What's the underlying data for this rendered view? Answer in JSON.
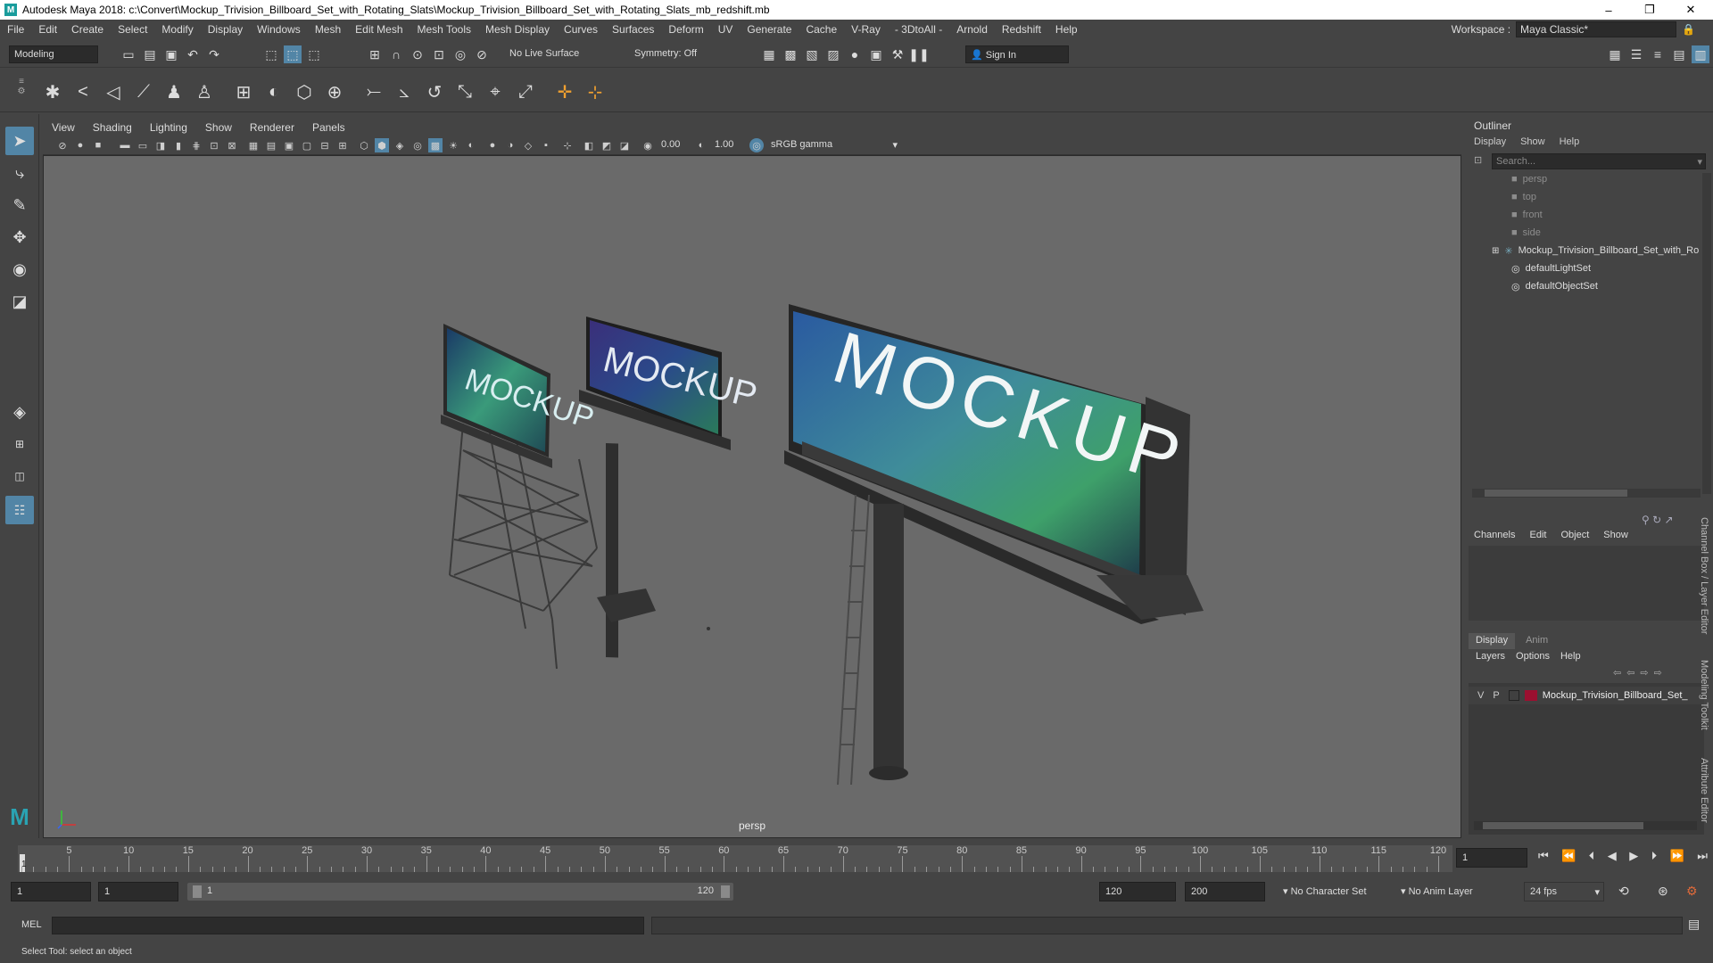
{
  "titlebar": {
    "title": "Autodesk Maya 2018: c:\\Convert\\Mockup_Trivision_Billboard_Set_with_Rotating_Slats\\Mockup_Trivision_Billboard_Set_with_Rotating_Slats_mb_redshift.mb",
    "minimize": "–",
    "maximize": "❐",
    "close": "✕"
  },
  "menubar": [
    "File",
    "Edit",
    "Create",
    "Select",
    "Modify",
    "Display",
    "Windows",
    "Mesh",
    "Edit Mesh",
    "Mesh Tools",
    "Mesh Display",
    "Curves",
    "Surfaces",
    "Deform",
    "UV",
    "Generate",
    "Cache",
    "V-Ray",
    "- 3DtoAll -",
    "Arnold",
    "Redshift",
    "Help"
  ],
  "workspace": {
    "label": "Workspace :",
    "value": "Maya Classic*"
  },
  "statusline": {
    "mode": "Modeling",
    "live_surface": "No Live Surface",
    "symmetry": "Symmetry: Off",
    "sign_in": "Sign In"
  },
  "panel": {
    "menus": [
      "View",
      "Shading",
      "Lighting",
      "Show",
      "Renderer",
      "Panels"
    ],
    "exposure": "0.00",
    "gamma": "1.00",
    "colorspace": "sRGB gamma",
    "camera_label": "persp"
  },
  "billboards": {
    "text": "MOCKUP"
  },
  "outliner": {
    "title": "Outliner",
    "menus": [
      "Display",
      "Show",
      "Help"
    ],
    "search_placeholder": "Search...",
    "items": [
      {
        "label": "persp",
        "dim": true,
        "icon": "camera-icon"
      },
      {
        "label": "top",
        "dim": true,
        "icon": "camera-icon"
      },
      {
        "label": "front",
        "dim": true,
        "icon": "camera-icon"
      },
      {
        "label": "side",
        "dim": true,
        "icon": "camera-icon"
      },
      {
        "label": "Mockup_Trivision_Billboard_Set_with_Ro",
        "dim": false,
        "icon": "group-icon"
      },
      {
        "label": "defaultLightSet",
        "dim": false,
        "icon": "set-icon"
      },
      {
        "label": "defaultObjectSet",
        "dim": false,
        "icon": "set-icon"
      }
    ]
  },
  "channelbox": {
    "menus": [
      "Channels",
      "Edit",
      "Object",
      "Show"
    ],
    "tabs": [
      "Display",
      "Anim"
    ],
    "layer_menus": [
      "Layers",
      "Options",
      "Help"
    ],
    "layer": {
      "v": "V",
      "p": "P",
      "name": "Mockup_Trivision_Billboard_Set_",
      "color": "#9b1030"
    }
  },
  "side_tabs": [
    "Channel Box / Layer Editor",
    "Modeling Toolkit",
    "Attribute Editor"
  ],
  "timeline": {
    "ticks": [
      "5",
      "10",
      "15",
      "20",
      "25",
      "30",
      "35",
      "40",
      "45",
      "50",
      "55",
      "60",
      "65",
      "70",
      "75",
      "80",
      "85",
      "90",
      "95",
      "100",
      "105",
      "110",
      "115",
      "120"
    ],
    "start_marker": "1",
    "current_frame": "1"
  },
  "range": {
    "start": "1",
    "playback_start": "1",
    "slider_start": "1",
    "slider_end": "120",
    "playback_end": "120",
    "end": "200",
    "character_set": "No Character Set",
    "anim_layer": "No Anim Layer",
    "fps": "24 fps"
  },
  "cmdline": {
    "label": "MEL"
  },
  "helpline": {
    "text": "Select Tool: select an object"
  }
}
